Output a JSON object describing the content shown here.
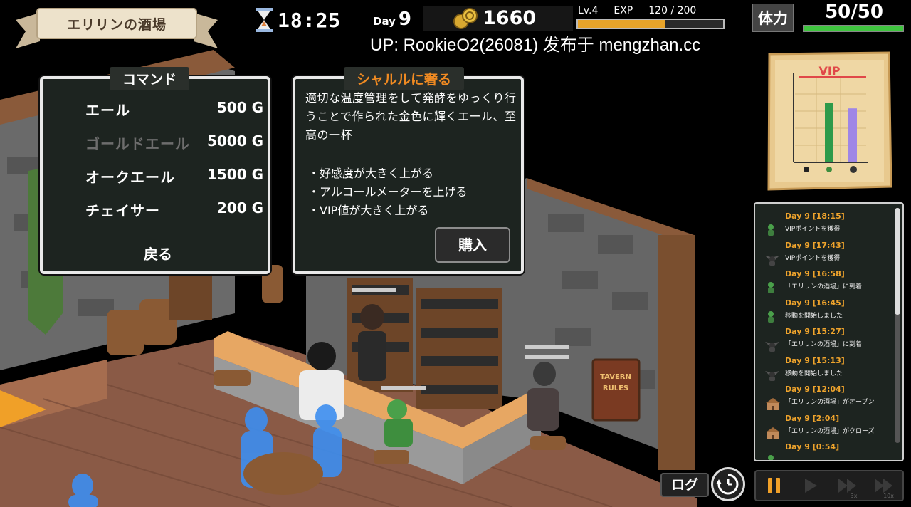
{
  "hud": {
    "location": "エリリンの酒場",
    "time": "18:25",
    "day_label": "Day",
    "day_number": "9",
    "gold": "1660",
    "level": "Lv.4",
    "exp_label": "EXP",
    "exp_text": "120 / 200",
    "exp_fraction": 0.6,
    "hp_label": "体力",
    "hp_text": "50/50",
    "hp_fraction": 1.0
  },
  "watermark": "UP: RookieO2(26081) 发布于 mengzhan.cc",
  "command_panel": {
    "title": "コマンド",
    "items": [
      {
        "name": "エール",
        "price": "500 G",
        "enabled": true
      },
      {
        "name": "ゴールドエール",
        "price": "5000 G",
        "enabled": false
      },
      {
        "name": "オークエール",
        "price": "1500 G",
        "enabled": true
      },
      {
        "name": "チェイサー",
        "price": "200 G",
        "enabled": true
      }
    ],
    "back": "戻る"
  },
  "detail_panel": {
    "title": "シャルルに奢る",
    "description": "適切な温度管理をして発酵をゆっくり行うことで作られた金色に輝くエール、至高の一杯",
    "bullets": [
      "・好感度が大きく上がる",
      "・アルコールメーターを上げる",
      "・VIP値が大きく上がる"
    ],
    "buy": "購入"
  },
  "vip_chart": {
    "title": "VIP",
    "bars": [
      {
        "value": 0,
        "color": "#2e9a4a"
      },
      {
        "value": 0.75,
        "color": "#2e9a4a"
      },
      {
        "value": 0.68,
        "color": "#9f86e6"
      }
    ]
  },
  "log": {
    "entries": [
      {
        "time": "Day 9 [18:15]",
        "message": "VIPポイントを獲得",
        "icon": "goblin-icon"
      },
      {
        "time": "Day 9 [17:43]",
        "message": "VIPポイントを獲得",
        "icon": "dark-elf-icon"
      },
      {
        "time": "Day 9 [16:58]",
        "message": "「エリリンの酒場」に到着",
        "icon": "goblin-icon"
      },
      {
        "time": "Day 9 [16:45]",
        "message": "移動を開始しました",
        "icon": "goblin-icon"
      },
      {
        "time": "Day 9 [15:27]",
        "message": "「エリリンの酒場」に到着",
        "icon": "dark-elf-icon"
      },
      {
        "time": "Day 9 [15:13]",
        "message": "移動を開始しました",
        "icon": "dark-elf-icon"
      },
      {
        "time": "Day 9 [12:04]",
        "message": "「エリリンの酒場」がオープン",
        "icon": "tavern-icon"
      },
      {
        "time": "Day 9 [2:04]",
        "message": "「エリリンの酒場」がクローズ",
        "icon": "tavern-icon"
      },
      {
        "time": "Day 9 [0:54]",
        "message": "",
        "icon": "goblin-icon"
      }
    ],
    "log_button": "ログ"
  },
  "speed_controls": {
    "labels": [
      "",
      "",
      "3x",
      "10x"
    ]
  },
  "colors": {
    "accent_orange": "#f08a22",
    "log_time": "#f0a42c",
    "hp_green": "#3fc43f",
    "exp_orange": "#e8a42a",
    "panel_bg": "#1d2420"
  }
}
